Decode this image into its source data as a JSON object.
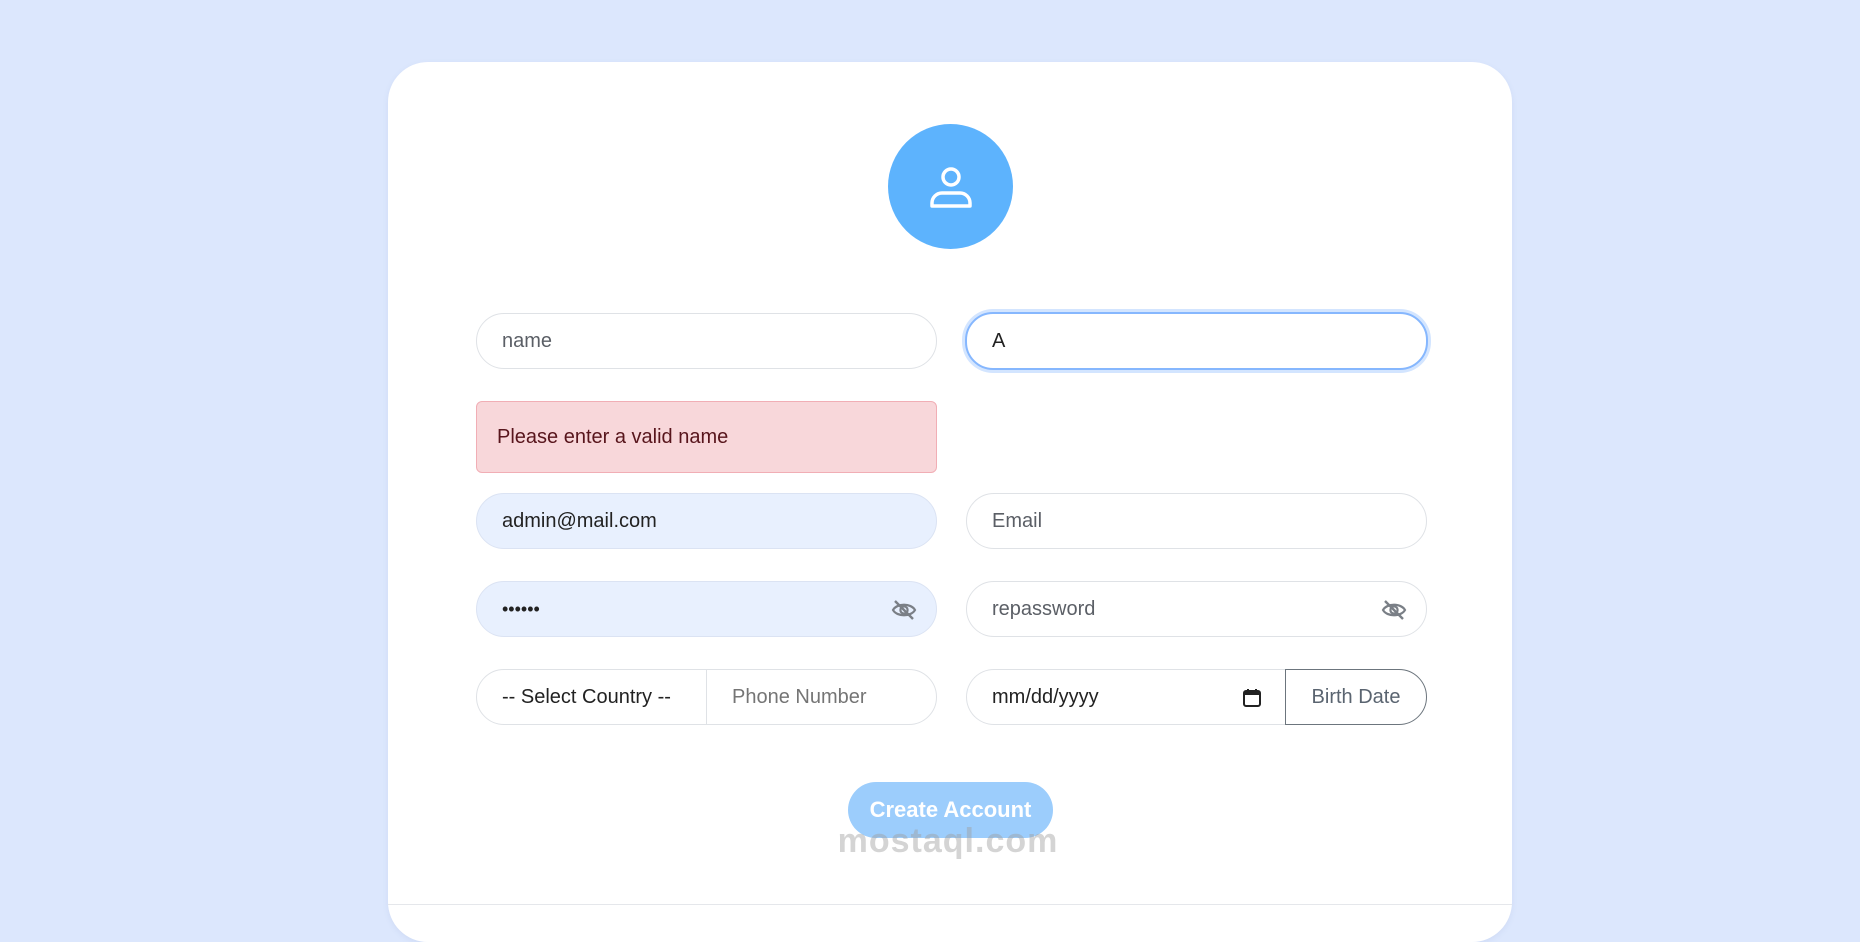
{
  "form": {
    "name_placeholder": "name",
    "second_name_value": "A",
    "error_message": "Please enter a valid name",
    "email_value": "admin@mail.com",
    "email_placeholder": "Email",
    "password_value": "••••••",
    "repassword_placeholder": "repassword",
    "country_select": "-- Select Country --",
    "phone_placeholder": "Phone Number",
    "date_placeholder": "mm/dd/yyyy",
    "birth_date_label": "Birth Date",
    "submit_label": "Create Account"
  },
  "watermark": "mostaql.com",
  "icons": {
    "avatar": "user-icon",
    "eye": "eye-slash-icon",
    "calendar": "calendar-icon"
  },
  "colors": {
    "background": "#dce7fd",
    "avatar": "#5db3fd",
    "button": "#9ccdfc",
    "alert_bg": "#f8d7da"
  }
}
